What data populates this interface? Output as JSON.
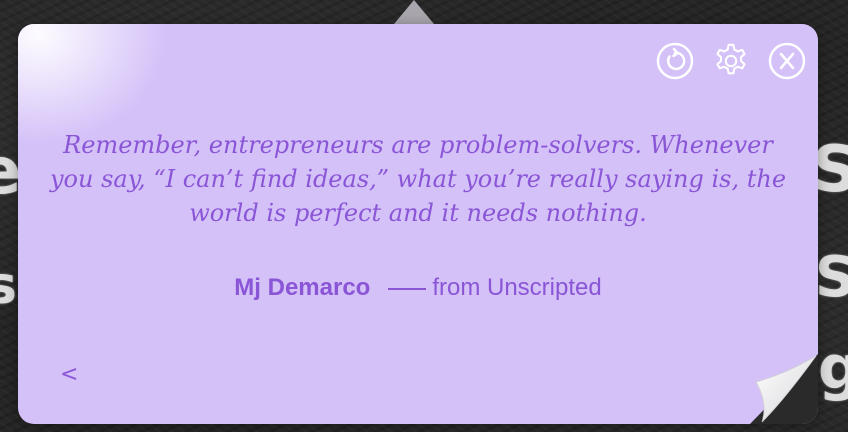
{
  "background": {
    "chalk_letters": [
      "e",
      "s",
      "S",
      "S",
      "g"
    ]
  },
  "toolbar": {
    "refresh_icon": "refresh-icon",
    "settings_icon": "gear-icon",
    "close_icon": "close-icon"
  },
  "quote": {
    "text": "Remember, entrepreneurs are problem-solvers. Whenever you say, “I can’t find ideas,” what you’re really saying is, the world is perfect and it needs nothing.",
    "author": "Mj Demarco",
    "source": "from Unscripted"
  },
  "nav": {
    "prev_label": "<"
  },
  "colors": {
    "card_background": "#d4c1f8",
    "accent": "#8a55d6",
    "icon": "#ffffff"
  }
}
